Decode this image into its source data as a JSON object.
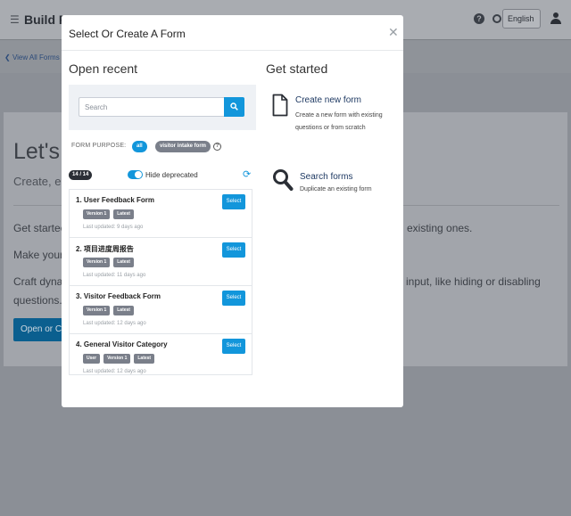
{
  "background": {
    "app_title": "Build Po",
    "language": "English",
    "back_link": "View All Forms",
    "hero_title": "Let's B",
    "hero_subtitle": "Create, ec",
    "line1_left": "Get startec",
    "line1_right": "existing ones.",
    "line2_left": "Make your",
    "line3_left": "Craft dyna",
    "line3_right": "input, like hiding or disabling",
    "line4_left": "questions.",
    "open_button": "Open or Cr"
  },
  "modal": {
    "title": "Select Or Create A Form",
    "open_recent": {
      "heading": "Open recent",
      "search_placeholder": "Search",
      "form_purpose_label": "FORM PURPOSE:",
      "purpose_all": "all",
      "purpose_visitor": "visitor intake form",
      "count": "14 / 14",
      "hide_deprecated": "Hide deprecated",
      "select_label": "Select",
      "forms": [
        {
          "name": "1. User Feedback Form",
          "tags": [
            "Version 1",
            "Latest"
          ],
          "updated": "Last updated: 9 days ago"
        },
        {
          "name": "2. 项目进度周报告",
          "tags": [
            "Version 1",
            "Latest"
          ],
          "updated": "Last updated: 11 days ago"
        },
        {
          "name": "3. Visitor Feedback Form",
          "tags": [
            "Version 1",
            "Latest"
          ],
          "updated": "Last updated: 12 days ago"
        },
        {
          "name": "4. General Visitor Category",
          "tags": [
            "User",
            "Version 1",
            "Latest"
          ],
          "updated": "Last updated: 12 days ago"
        }
      ]
    },
    "get_started": {
      "heading": "Get started",
      "create_title": "Create new form",
      "create_desc": "Create a new form with existing questions or from scratch",
      "search_title": "Search forms",
      "search_desc": "Duplicate an existing form"
    }
  },
  "colors": {
    "accent": "#1296db",
    "tag": "#7a7f8a",
    "link": "#1f3a63"
  }
}
